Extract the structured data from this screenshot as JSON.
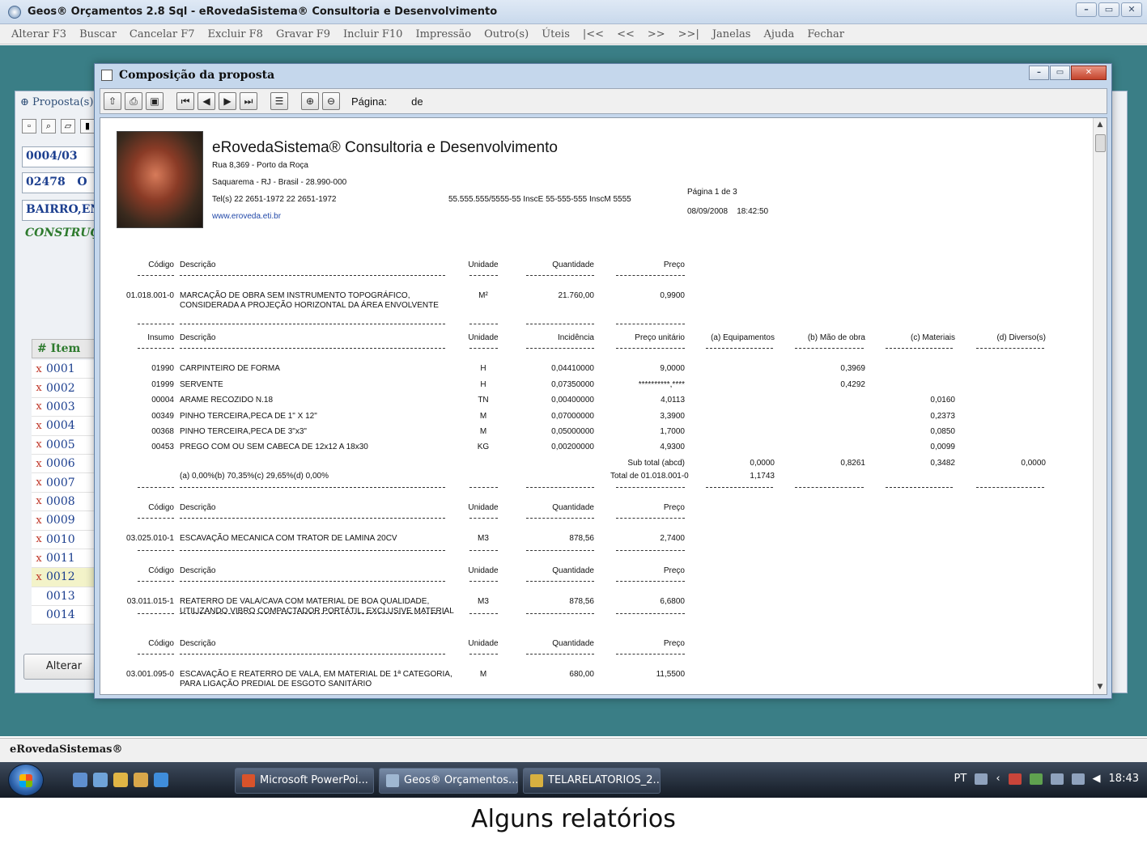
{
  "app": {
    "title": "Geos® Orçamentos 2.8 Sql - eRovedaSistema® Consultoria e Desenvolvimento",
    "menu": [
      "Alterar F3",
      "Buscar",
      "Cancelar F7",
      "Excluir F8",
      "Gravar F9",
      "Incluir F10",
      "Impressão",
      "Outro(s)",
      "Úteis",
      "|<<",
      "<<",
      ">>",
      ">>|",
      "Janelas",
      "Ajuda",
      "Fechar"
    ],
    "status": "eRovedaSistemas®"
  },
  "child_form": {
    "tab": "Proposta(s)",
    "fields": [
      "0004/03",
      "02478",
      "BAIRRO,ENI",
      "CONSTRUÇÃ"
    ],
    "field_suffix": "O",
    "grid_header": "#  Item",
    "rows": [
      "0001",
      "0002",
      "0003",
      "0004",
      "0005",
      "0006",
      "0007",
      "0008",
      "0009",
      "0010",
      "0011",
      "0012",
      "0013",
      "0014"
    ],
    "marked_rows": 12,
    "current_row": "0012",
    "alter_button": "Alterar"
  },
  "dialog": {
    "title": "Composição da proposta",
    "toolbar": {
      "page_label": "Página:",
      "de_label": "de"
    }
  },
  "report": {
    "company": "eRovedaSistema® Consultoria e Desenvolvimento",
    "address1": "Rua 8,369 - Porto da Roça",
    "address2": "Saquarema - RJ - Brasil - 28.990-000",
    "tel": "Tel(s) 22 2651-1972 22 2651-1972",
    "site": "www.eroveda.eti.br",
    "registrations": "55.555.555/5555-55 InscE 55-555-555 InscM 5555",
    "page_text": "Página     1       de    3",
    "date": "08/09/2008",
    "time": "18:42:50",
    "headers": {
      "codigo": "Código",
      "descricao": "Descrição",
      "unidade": "Unidade",
      "quantidade": "Quantidade",
      "preco": "Preço",
      "insumo": "Insumo",
      "incidencia": "Incidência",
      "preco_unitario": "Preço unitário",
      "equip": "(a) Equipamentos",
      "mao": "(b) Mão de obra",
      "mat": "(c) Materiais",
      "div": "(d) Diverso(s)"
    },
    "item1": {
      "code": "01.018.001-0",
      "desc1": "MARCAÇÃO DE OBRA SEM INSTRUMENTO TOPOGRÁFICO,",
      "desc2": "CONSIDERADA A PROJEÇÃO HORIZONTAL DA ÁREA ENVOLVENTE",
      "unit": "M²",
      "qty": "21.760,00",
      "price": "0,9900"
    },
    "inputs": [
      {
        "code": "01990",
        "desc": "CARPINTEIRO DE FORMA",
        "unit": "H",
        "inc": "0,04410000",
        "unit_price": "9,0000",
        "mao": "0,3969",
        "mat": ""
      },
      {
        "code": "01999",
        "desc": "SERVENTE",
        "unit": "H",
        "inc": "0,07350000",
        "unit_price": "**********,****",
        "mao": "0,4292",
        "mat": ""
      },
      {
        "code": "00004",
        "desc": "ARAME RECOZIDO N.18",
        "unit": "TN",
        "inc": "0,00400000",
        "unit_price": "4,0113",
        "mao": "",
        "mat": "0,0160"
      },
      {
        "code": "00349",
        "desc": "PINHO TERCEIRA,PECA DE 1\" X 12\"",
        "unit": "M",
        "inc": "0,07000000",
        "unit_price": "3,3900",
        "mao": "",
        "mat": "0,2373"
      },
      {
        "code": "00368",
        "desc": "PINHO TERCEIRA,PECA DE 3\"x3\"",
        "unit": "M",
        "inc": "0,05000000",
        "unit_price": "1,7000",
        "mao": "",
        "mat": "0,0850"
      },
      {
        "code": "00453",
        "desc": "PREGO COM OU SEM CABECA DE 12x12 A 18x30",
        "unit": "KG",
        "inc": "0,00200000",
        "unit_price": "4,9300",
        "mao": "",
        "mat": "0,0099"
      }
    ],
    "subtotal_label": "Sub total (abcd)",
    "subtotal": {
      "a": "0,0000",
      "b": "0,8261",
      "c": "0,3482",
      "d": "0,0000"
    },
    "percentages": "(a)  0,00%(b)  70,35%(c)  29,65%(d)  0,00%",
    "total_label": "Total de 01.018.001-0",
    "total_value": "1,1743",
    "items": [
      {
        "code": "03.025.010-1",
        "desc1": "ESCAVAÇÃO MECANICA COM TRATOR DE LAMINA 20CV",
        "desc2": "",
        "unit": "M3",
        "qty": "878,56",
        "price": "2,7400"
      },
      {
        "code": "03.011.015-1",
        "desc1": "REATERRO DE VALA/CAVA COM MATERIAL DE BOA QUALIDADE,",
        "desc2": "UTILIZANDO VIBRO COMPACTADOR PORTÁTIL, EXCLUSIVE MATERIAL",
        "unit": "M3",
        "qty": "878,56",
        "price": "6,6800"
      },
      {
        "code": "03.001.095-0",
        "desc1": "ESCAVAÇÃO E REATERRO DE VALA, EM MATERIAL DE 1ª CATEGORIA,",
        "desc2": "PARA LIGAÇÃO PREDIAL DE ESGOTO SANITÁRIO",
        "unit": "M",
        "qty": "680,00",
        "price": "11,5500"
      }
    ]
  },
  "taskbar": {
    "tasks": [
      "Microsoft PowerPoi...",
      "Geos® Orçamentos...",
      "TELARELATORIOS_2..."
    ],
    "lang": "PT",
    "clock": "18:43"
  },
  "caption": "Alguns relatórios"
}
